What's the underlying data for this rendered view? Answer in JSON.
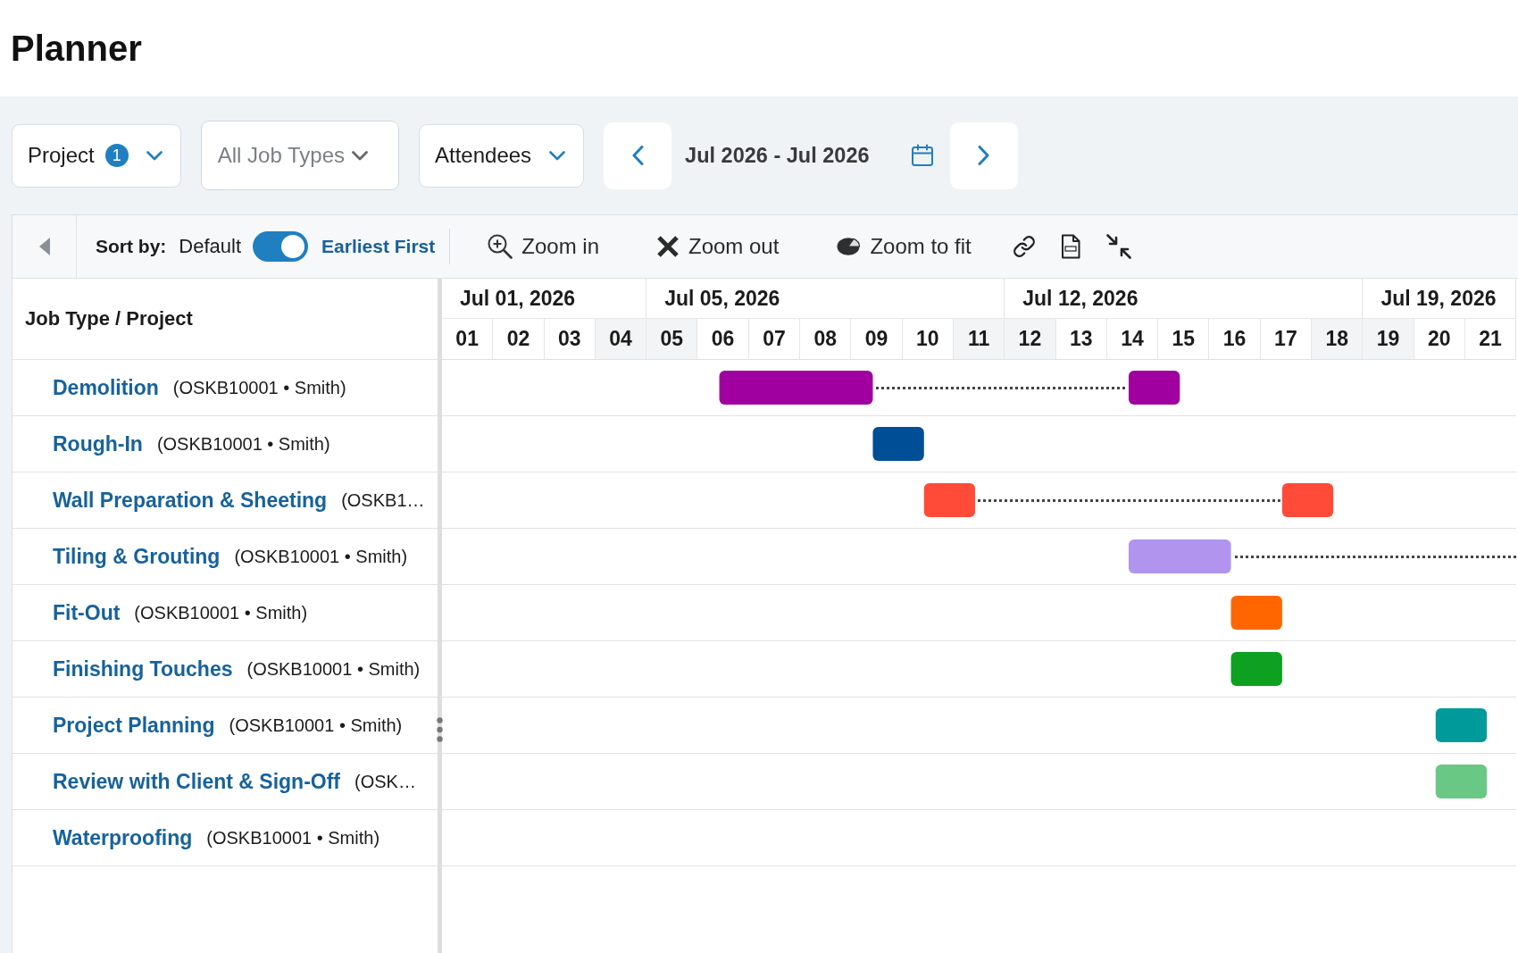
{
  "page": {
    "title": "Planner"
  },
  "filters": [
    {
      "kind": "dropdown",
      "label": "Project",
      "badge": "1"
    },
    {
      "kind": "select",
      "placeholder": "All Job Types"
    },
    {
      "kind": "dropdown",
      "label": "Attendees"
    }
  ],
  "date_range": {
    "value": "Jul 2026 - Jul 2026"
  },
  "toolbar": {
    "sort": {
      "label": "Sort by:",
      "off_label": "Default",
      "on_label": "Earliest First",
      "on": true
    },
    "actions": [
      {
        "kind": "zoom_in",
        "label": "Zoom in"
      },
      {
        "kind": "zoom_out",
        "label": "Zoom out"
      },
      {
        "kind": "zoom_fit",
        "label": "Zoom to fit"
      },
      {
        "kind": "link"
      },
      {
        "kind": "pdf"
      },
      {
        "kind": "collapse"
      }
    ]
  },
  "grid": {
    "column_header": "Job Type / Project",
    "weeks": [
      {
        "label": "Jul 01, 2026",
        "days": [
          {
            "label": "01",
            "weekend": false
          },
          {
            "label": "02",
            "weekend": false
          },
          {
            "label": "03",
            "weekend": false
          },
          {
            "label": "04",
            "weekend": true
          }
        ]
      },
      {
        "label": "Jul 05, 2026",
        "days": [
          {
            "label": "05",
            "weekend": true
          },
          {
            "label": "06",
            "weekend": false
          },
          {
            "label": "07",
            "weekend": false
          },
          {
            "label": "08",
            "weekend": false
          },
          {
            "label": "09",
            "weekend": false
          },
          {
            "label": "10",
            "weekend": false
          },
          {
            "label": "11",
            "weekend": true
          }
        ]
      },
      {
        "label": "Jul 12, 2026",
        "days": [
          {
            "label": "12",
            "weekend": true
          },
          {
            "label": "13",
            "weekend": false
          },
          {
            "label": "14",
            "weekend": false
          },
          {
            "label": "15",
            "weekend": false
          },
          {
            "label": "16",
            "weekend": false
          },
          {
            "label": "17",
            "weekend": false
          },
          {
            "label": "18",
            "weekend": true
          }
        ]
      },
      {
        "label": "Jul 19, 2026",
        "days": [
          {
            "label": "19",
            "weekend": true
          },
          {
            "label": "20",
            "weekend": false
          },
          {
            "label": "21",
            "weekend": false
          }
        ]
      }
    ],
    "tasks": [
      {
        "name": "Demolition",
        "detail": "(OSKB10001 • Smith)",
        "color": "#a000a0",
        "continues": false
      },
      {
        "name": "Rough-In",
        "detail": "(OSKB10001 • Smith)",
        "color": "#004e96",
        "continues": false
      },
      {
        "name": "Wall Preparation & Sheeting",
        "detail": "(OSKB1…",
        "color": "#ff4b37",
        "continues": false
      },
      {
        "name": "Tiling & Grouting",
        "detail": "(OSKB10001 • Smith)",
        "color": "#b194ee",
        "continues": true
      },
      {
        "name": "Fit-Out",
        "detail": "(OSKB10001 • Smith)",
        "color": "#ff6600",
        "continues": false
      },
      {
        "name": "Finishing Touches",
        "detail": "(OSKB10001 • Smith)",
        "color": "#0ea020",
        "continues": false
      },
      {
        "name": "Project Planning",
        "detail": "(OSKB10001 • Smith)",
        "color": "#009a9a",
        "continues": false
      },
      {
        "name": "Review with Client & Sign-Off",
        "detail": "(OSK…",
        "color": "#69c883",
        "continues": false
      },
      {
        "name": "Waterproofing",
        "detail": "(OSKB10001 • Smith)",
        "continues": false
      }
    ]
  }
}
